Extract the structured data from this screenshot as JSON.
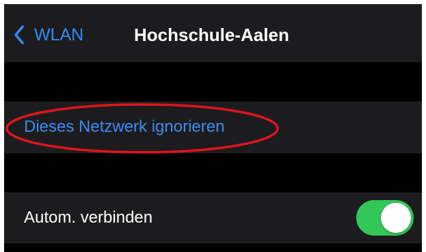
{
  "nav": {
    "back_label": "WLAN",
    "title": "Hochschule-Aalen"
  },
  "actions": {
    "ignore_network_label": "Dieses Netzwerk ignorieren"
  },
  "settings": {
    "auto_join_label": "Autom. verbinden",
    "auto_join_enabled": true
  },
  "colors": {
    "accent": "#2f8cf7",
    "toggle_on": "#33c759",
    "annotation": "#e0141e"
  },
  "icons": {
    "back": "chevron-left-icon"
  }
}
